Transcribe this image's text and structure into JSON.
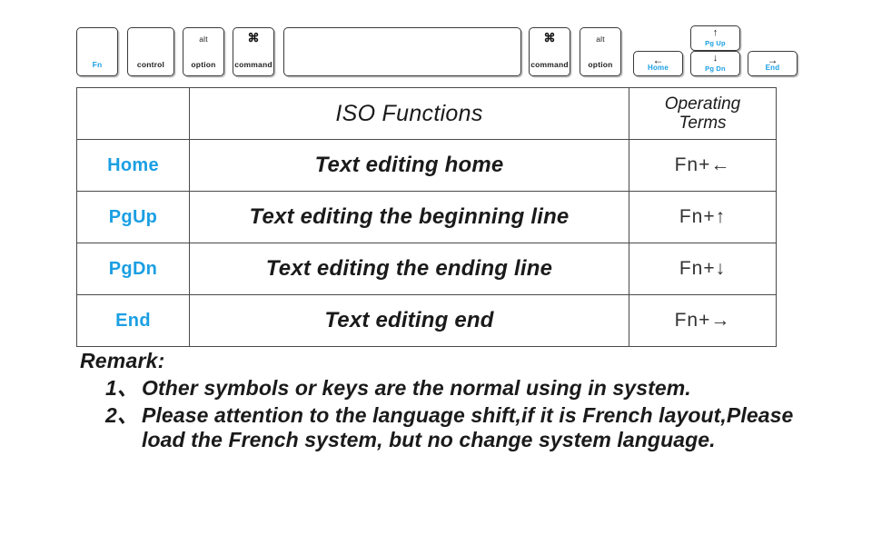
{
  "keyboard": {
    "keys": [
      {
        "id": "fn",
        "name": "key-fn",
        "label": "Fn",
        "cyan": true
      },
      {
        "id": "control",
        "name": "key-control",
        "label": "control",
        "cyan": false
      },
      {
        "id": "altopt",
        "name": "key-alt-option",
        "top": "alt",
        "label": "option",
        "cyan": false
      },
      {
        "id": "command",
        "name": "key-command-left",
        "glyph": "⌘",
        "label": "command",
        "cyan": false
      },
      {
        "id": "space",
        "name": "key-spacebar",
        "label": "",
        "cyan": false
      },
      {
        "id": "commandr",
        "name": "key-command-right",
        "glyph": "⌘",
        "label": "command",
        "cyan": false
      },
      {
        "id": "altoptr",
        "name": "key-alt-option-right",
        "top": "alt",
        "label": "option",
        "cyan": false
      },
      {
        "id": "home",
        "name": "key-arrow-left-home",
        "glyph": "←",
        "label": "Home",
        "cyan": true
      },
      {
        "id": "pgup",
        "name": "key-arrow-up-pgup",
        "glyph": "↑",
        "label": "Pg Up",
        "cyan": true
      },
      {
        "id": "pgdn",
        "name": "key-arrow-down-pgdn",
        "glyph": "↓",
        "label": "Pg Dn",
        "cyan": true
      },
      {
        "id": "end",
        "name": "key-arrow-right-end",
        "glyph": "→",
        "label": "End",
        "cyan": true
      }
    ]
  },
  "table": {
    "headers": {
      "key_column": "",
      "functions": "ISO Functions",
      "operating_terms_line1": "Operating",
      "operating_terms_line2": "Terms"
    },
    "rows": [
      {
        "key": "Home",
        "function": "Text editing home",
        "operation": "Fn+←"
      },
      {
        "key": "PgUp",
        "function": "Text editing the beginning line",
        "operation": "Fn+↑"
      },
      {
        "key": "PgDn",
        "function": "Text editing the ending line",
        "operation": "Fn+↓"
      },
      {
        "key": "End",
        "function": "Text editing end",
        "operation": "Fn+→"
      }
    ]
  },
  "remark": {
    "title": "Remark:",
    "items": [
      {
        "number": "1、",
        "text": "Other symbols or keys are the normal using in system."
      },
      {
        "number": "2、",
        "text": "Please attention to the language shift,if it is French layout,Please load the French system, but no change system language."
      }
    ]
  },
  "colors": {
    "key_label_cyan": "#1b9fe3",
    "text_dark": "#1a1a1a",
    "border": "#4a4a4a",
    "background": "#ffffff"
  }
}
